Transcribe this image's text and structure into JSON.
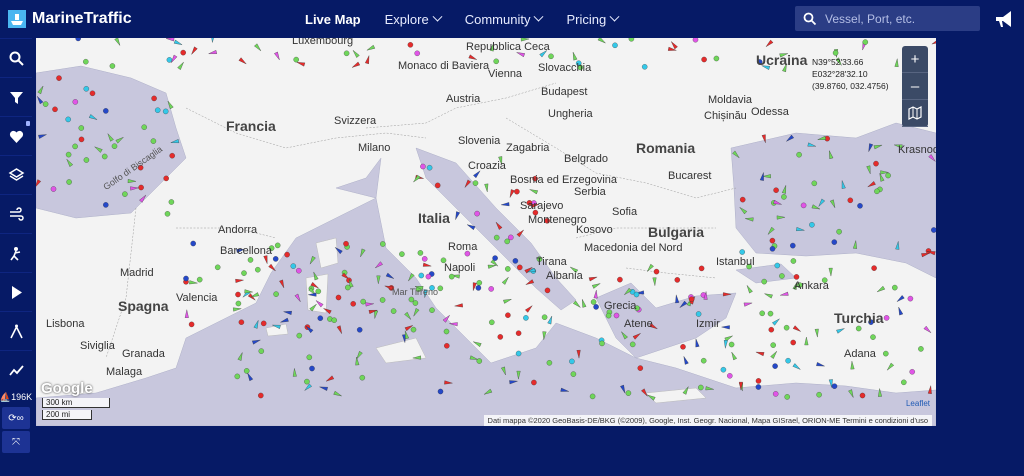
{
  "brand": {
    "name": "MarineTraffic"
  },
  "nav": [
    {
      "label": "Live Map",
      "active": true,
      "dropdown": false
    },
    {
      "label": "Explore",
      "active": false,
      "dropdown": true
    },
    {
      "label": "Community",
      "active": false,
      "dropdown": true
    },
    {
      "label": "Pricing",
      "active": false,
      "dropdown": true
    }
  ],
  "search": {
    "placeholder": "Vessel, Port, etc."
  },
  "sidebar": {
    "tools": [
      "search-icon",
      "filter-icon",
      "heart-icon",
      "layers-icon",
      "wind-icon",
      "density-icon",
      "play-icon",
      "measure-icon",
      "analytics-icon"
    ],
    "vessel_count": "196K"
  },
  "map": {
    "coords": {
      "lat": "N39°52'33.66",
      "lon": "E032°28'32.10",
      "decimal": "(39.8760, 032.4756)"
    },
    "zoom_in": "+",
    "scale": {
      "km": "300 km",
      "mi": "200 mi"
    },
    "google": "Google",
    "leaflet": "Leaflet",
    "attribution": "Dati mappa ©2020 GeoBasis-DE/BKG (©2009), Google, Inst. Geogr. Nacional, Mapa GISrael, ORION-ME   Termini e condizioni d'uso",
    "colors": {
      "sea": "#c8c7dd",
      "land": "#f3f3f3",
      "cargo": "#6fd65a",
      "tanker": "#e52b2b",
      "passenger": "#2548c8",
      "tug": "#34c8e8",
      "pleasure": "#e055e6"
    },
    "labels": {
      "countries": [
        "Francia",
        "Italia",
        "Spagna",
        "Romania",
        "Bulgaria",
        "Turchia",
        "Ucraina"
      ],
      "places": [
        "Repubblica Ceca",
        "Slovacchia",
        "Monaco di Baviera",
        "Vienna",
        "Budapest",
        "Austria",
        "Ungheria",
        "Moldavia",
        "Chișinău",
        "Odessa",
        "Svizzera",
        "Milano",
        "Slovenia",
        "Zagabria",
        "Croazia",
        "Bosnia ed Erzegovina",
        "Sarajevo",
        "Serbia",
        "Belgrado",
        "Montenegro",
        "Kosovo",
        "Macedonia del Nord",
        "Albania",
        "Tirana",
        "Grecia",
        "Atene",
        "Izmir",
        "Istanbul",
        "Ankara",
        "Adana",
        "Roma",
        "Bucarest",
        "Sofia",
        "Andorra",
        "Barcellona",
        "Madrid",
        "Valencia",
        "Lisbona",
        "Siviglia",
        "Granada",
        "Malaga",
        "Napoli",
        "Krasnodar",
        "Luxembourg"
      ],
      "seas": [
        "Mar Tirreno",
        "Golfo di Biscaglia"
      ]
    }
  }
}
